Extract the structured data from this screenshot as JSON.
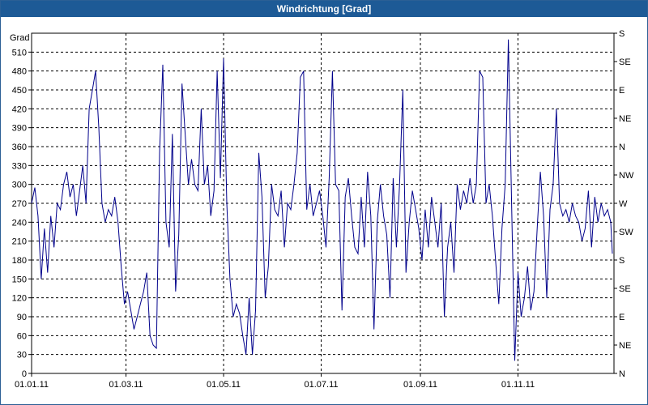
{
  "window": {
    "title": "Windrichtung [Grad]"
  },
  "chart_data": {
    "type": "line",
    "title": "Windrichtung [Grad]",
    "ylabel": "Grad",
    "xlabel": "",
    "ylim": [
      0,
      540
    ],
    "xlim": [
      "2011-01-01",
      "2011-12-31"
    ],
    "grid": true,
    "line_color": "#00008b",
    "x_ticks": [
      {
        "date": "2011-01-01",
        "label": "01.01.11"
      },
      {
        "date": "2011-03-01",
        "label": "01.03.11"
      },
      {
        "date": "2011-05-01",
        "label": "01.05.11"
      },
      {
        "date": "2011-07-01",
        "label": "01.07.11"
      },
      {
        "date": "2011-09-01",
        "label": "01.09.11"
      },
      {
        "date": "2011-11-01",
        "label": "01.11.11"
      }
    ],
    "y_ticks": [
      0,
      30,
      60,
      90,
      120,
      150,
      180,
      210,
      240,
      270,
      300,
      330,
      360,
      390,
      420,
      450,
      480,
      510
    ],
    "right_axis": [
      {
        "value": 0,
        "label": "N"
      },
      {
        "value": 45,
        "label": "NE"
      },
      {
        "value": 90,
        "label": "E"
      },
      {
        "value": 135,
        "label": "SE"
      },
      {
        "value": 180,
        "label": "S"
      },
      {
        "value": 225,
        "label": "SW"
      },
      {
        "value": 270,
        "label": "W"
      },
      {
        "value": 315,
        "label": "NW"
      },
      {
        "value": 360,
        "label": "N"
      },
      {
        "value": 405,
        "label": "NE"
      },
      {
        "value": 450,
        "label": "E"
      },
      {
        "value": 495,
        "label": "SE"
      },
      {
        "value": 540,
        "label": "S"
      }
    ],
    "series": [
      {
        "values": [
          [
            1,
            270
          ],
          [
            3,
            295
          ],
          [
            5,
            250
          ],
          [
            7,
            150
          ],
          [
            9,
            230
          ],
          [
            11,
            160
          ],
          [
            13,
            250
          ],
          [
            15,
            200
          ],
          [
            17,
            270
          ],
          [
            19,
            260
          ],
          [
            21,
            300
          ],
          [
            23,
            320
          ],
          [
            25,
            280
          ],
          [
            27,
            300
          ],
          [
            29,
            250
          ],
          [
            31,
            290
          ],
          [
            33,
            330
          ],
          [
            35,
            270
          ],
          [
            37,
            420
          ],
          [
            39,
            450
          ],
          [
            41,
            480
          ],
          [
            43,
            390
          ],
          [
            45,
            270
          ],
          [
            47,
            240
          ],
          [
            49,
            260
          ],
          [
            51,
            250
          ],
          [
            53,
            280
          ],
          [
            55,
            240
          ],
          [
            57,
            170
          ],
          [
            59,
            110
          ],
          [
            61,
            130
          ],
          [
            63,
            100
          ],
          [
            65,
            70
          ],
          [
            67,
            90
          ],
          [
            69,
            110
          ],
          [
            71,
            130
          ],
          [
            73,
            160
          ],
          [
            75,
            60
          ],
          [
            77,
            45
          ],
          [
            79,
            40
          ],
          [
            81,
            350
          ],
          [
            83,
            490
          ],
          [
            85,
            240
          ],
          [
            87,
            200
          ],
          [
            89,
            380
          ],
          [
            91,
            130
          ],
          [
            93,
            220
          ],
          [
            95,
            460
          ],
          [
            97,
            380
          ],
          [
            99,
            300
          ],
          [
            101,
            340
          ],
          [
            103,
            300
          ],
          [
            105,
            290
          ],
          [
            107,
            420
          ],
          [
            109,
            300
          ],
          [
            111,
            330
          ],
          [
            113,
            250
          ],
          [
            115,
            290
          ],
          [
            117,
            480
          ],
          [
            119,
            310
          ],
          [
            121,
            500
          ],
          [
            123,
            270
          ],
          [
            125,
            150
          ],
          [
            127,
            90
          ],
          [
            129,
            110
          ],
          [
            131,
            95
          ],
          [
            133,
            60
          ],
          [
            135,
            30
          ],
          [
            137,
            120
          ],
          [
            139,
            30
          ],
          [
            141,
            100
          ],
          [
            143,
            350
          ],
          [
            145,
            280
          ],
          [
            147,
            120
          ],
          [
            149,
            170
          ],
          [
            151,
            300
          ],
          [
            153,
            260
          ],
          [
            155,
            250
          ],
          [
            157,
            290
          ],
          [
            159,
            200
          ],
          [
            161,
            270
          ],
          [
            163,
            260
          ],
          [
            165,
            300
          ],
          [
            167,
            350
          ],
          [
            169,
            470
          ],
          [
            171,
            480
          ],
          [
            173,
            260
          ],
          [
            175,
            300
          ],
          [
            177,
            250
          ],
          [
            179,
            270
          ],
          [
            181,
            290
          ],
          [
            183,
            250
          ],
          [
            185,
            200
          ],
          [
            187,
            310
          ],
          [
            189,
            480
          ],
          [
            191,
            300
          ],
          [
            193,
            290
          ],
          [
            195,
            100
          ],
          [
            197,
            280
          ],
          [
            199,
            310
          ],
          [
            201,
            250
          ],
          [
            203,
            200
          ],
          [
            205,
            190
          ],
          [
            207,
            280
          ],
          [
            209,
            200
          ],
          [
            211,
            320
          ],
          [
            213,
            250
          ],
          [
            215,
            70
          ],
          [
            217,
            240
          ],
          [
            219,
            300
          ],
          [
            221,
            250
          ],
          [
            223,
            220
          ],
          [
            225,
            120
          ],
          [
            227,
            310
          ],
          [
            229,
            200
          ],
          [
            231,
            300
          ],
          [
            233,
            450
          ],
          [
            235,
            160
          ],
          [
            237,
            240
          ],
          [
            239,
            290
          ],
          [
            241,
            260
          ],
          [
            243,
            230
          ],
          [
            245,
            180
          ],
          [
            247,
            260
          ],
          [
            249,
            200
          ],
          [
            251,
            280
          ],
          [
            253,
            240
          ],
          [
            255,
            200
          ],
          [
            257,
            270
          ],
          [
            259,
            90
          ],
          [
            261,
            200
          ],
          [
            263,
            240
          ],
          [
            265,
            160
          ],
          [
            267,
            300
          ],
          [
            269,
            260
          ],
          [
            271,
            290
          ],
          [
            273,
            270
          ],
          [
            275,
            310
          ],
          [
            277,
            270
          ],
          [
            279,
            300
          ],
          [
            281,
            480
          ],
          [
            283,
            470
          ],
          [
            285,
            270
          ],
          [
            287,
            300
          ],
          [
            289,
            250
          ],
          [
            291,
            180
          ],
          [
            293,
            110
          ],
          [
            295,
            230
          ],
          [
            297,
            300
          ],
          [
            299,
            530
          ],
          [
            301,
            270
          ],
          [
            303,
            20
          ],
          [
            305,
            160
          ],
          [
            307,
            90
          ],
          [
            309,
            120
          ],
          [
            311,
            170
          ],
          [
            313,
            100
          ],
          [
            315,
            130
          ],
          [
            317,
            230
          ],
          [
            319,
            320
          ],
          [
            321,
            250
          ],
          [
            323,
            120
          ],
          [
            325,
            260
          ],
          [
            327,
            300
          ],
          [
            329,
            420
          ],
          [
            331,
            270
          ],
          [
            333,
            250
          ],
          [
            335,
            260
          ],
          [
            337,
            240
          ],
          [
            339,
            270
          ],
          [
            341,
            250
          ],
          [
            343,
            240
          ],
          [
            345,
            210
          ],
          [
            347,
            230
          ],
          [
            349,
            290
          ],
          [
            351,
            200
          ],
          [
            353,
            280
          ],
          [
            355,
            240
          ],
          [
            357,
            270
          ],
          [
            359,
            250
          ],
          [
            361,
            260
          ],
          [
            363,
            240
          ],
          [
            364,
            190
          ]
        ]
      }
    ]
  }
}
